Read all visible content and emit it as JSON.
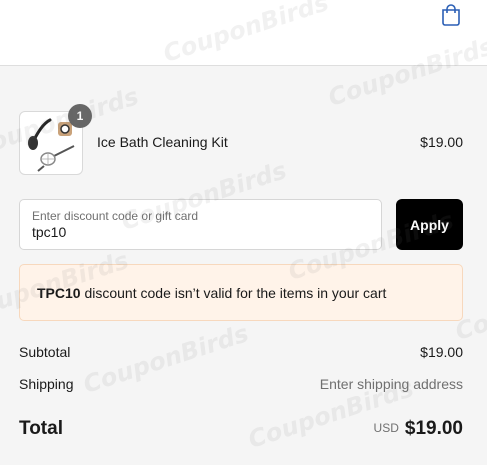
{
  "header": {
    "cart_icon": "shopping-bag-icon"
  },
  "cart": {
    "item": {
      "name": "Ice Bath Cleaning Kit",
      "price": "$19.00",
      "quantity": "1",
      "thumbnail_icon": "cleaning-tools-image"
    }
  },
  "discount": {
    "placeholder": "Enter discount code or gift card",
    "value": "tpc10",
    "apply_label": "Apply"
  },
  "error": {
    "code": "TPC10",
    "message": " discount code isn’t valid for the items in your cart"
  },
  "summary": {
    "subtotal_label": "Subtotal",
    "subtotal_value": "$19.00",
    "shipping_label": "Shipping",
    "shipping_value": "Enter shipping address",
    "total_label": "Total",
    "currency": "USD",
    "total_value": "$19.00"
  },
  "watermark": {
    "text": "CouponBirds"
  },
  "colors": {
    "page_bg": "#f5f5f5",
    "button_bg": "#000000",
    "error_bg": "#fff3e9",
    "error_border": "#f7d8bd",
    "muted_text": "#707070"
  }
}
